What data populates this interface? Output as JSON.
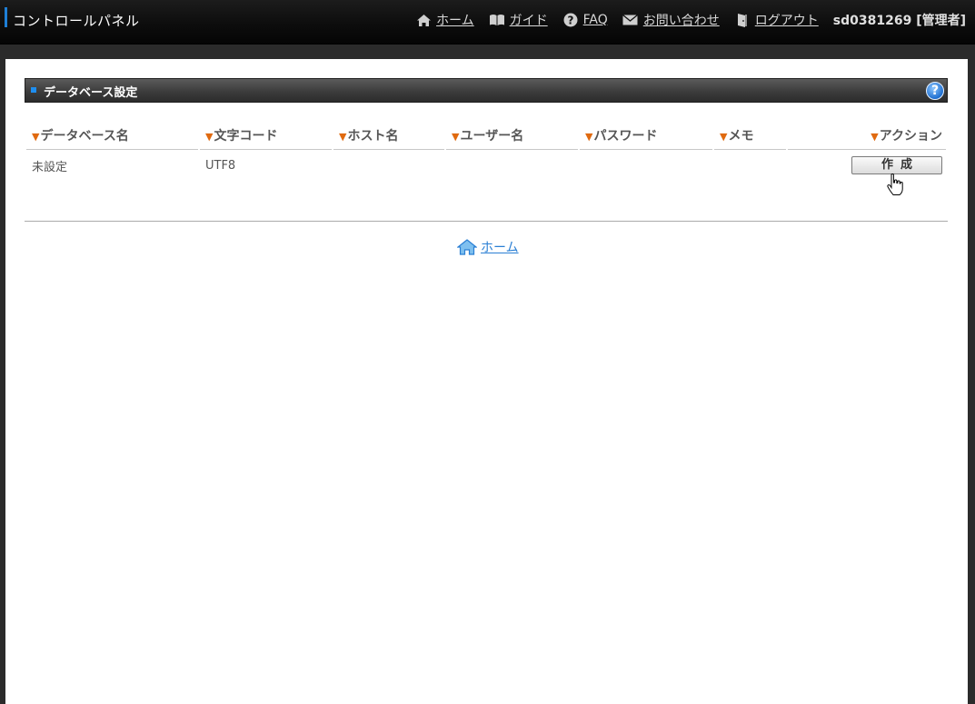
{
  "app": {
    "title": "コントロールパネル"
  },
  "topnav": {
    "items": [
      {
        "label": "ホーム",
        "icon": "home-icon"
      },
      {
        "label": "ガイド",
        "icon": "book-icon"
      },
      {
        "label": "FAQ",
        "icon": "question-icon"
      },
      {
        "label": "お問い合わせ",
        "icon": "mail-icon"
      },
      {
        "label": "ログアウト",
        "icon": "door-icon"
      }
    ],
    "user": "sd0381269 [管理者]"
  },
  "section": {
    "title": "データベース設定",
    "help_symbol": "?"
  },
  "table": {
    "headers": [
      "データベース名",
      "文字コード",
      "ホスト名",
      "ユーザー名",
      "パスワード",
      "メモ",
      "アクション"
    ],
    "rows": [
      {
        "db_name": "未設定",
        "charset": "UTF8",
        "host": "",
        "user": "",
        "password": "",
        "memo": "",
        "action_label": "作成"
      }
    ]
  },
  "footer": {
    "home_label": "ホーム"
  },
  "colors": {
    "accent": "#1e7fd6",
    "header_triangle": "#e06a10",
    "link": "#2a7fd4"
  }
}
